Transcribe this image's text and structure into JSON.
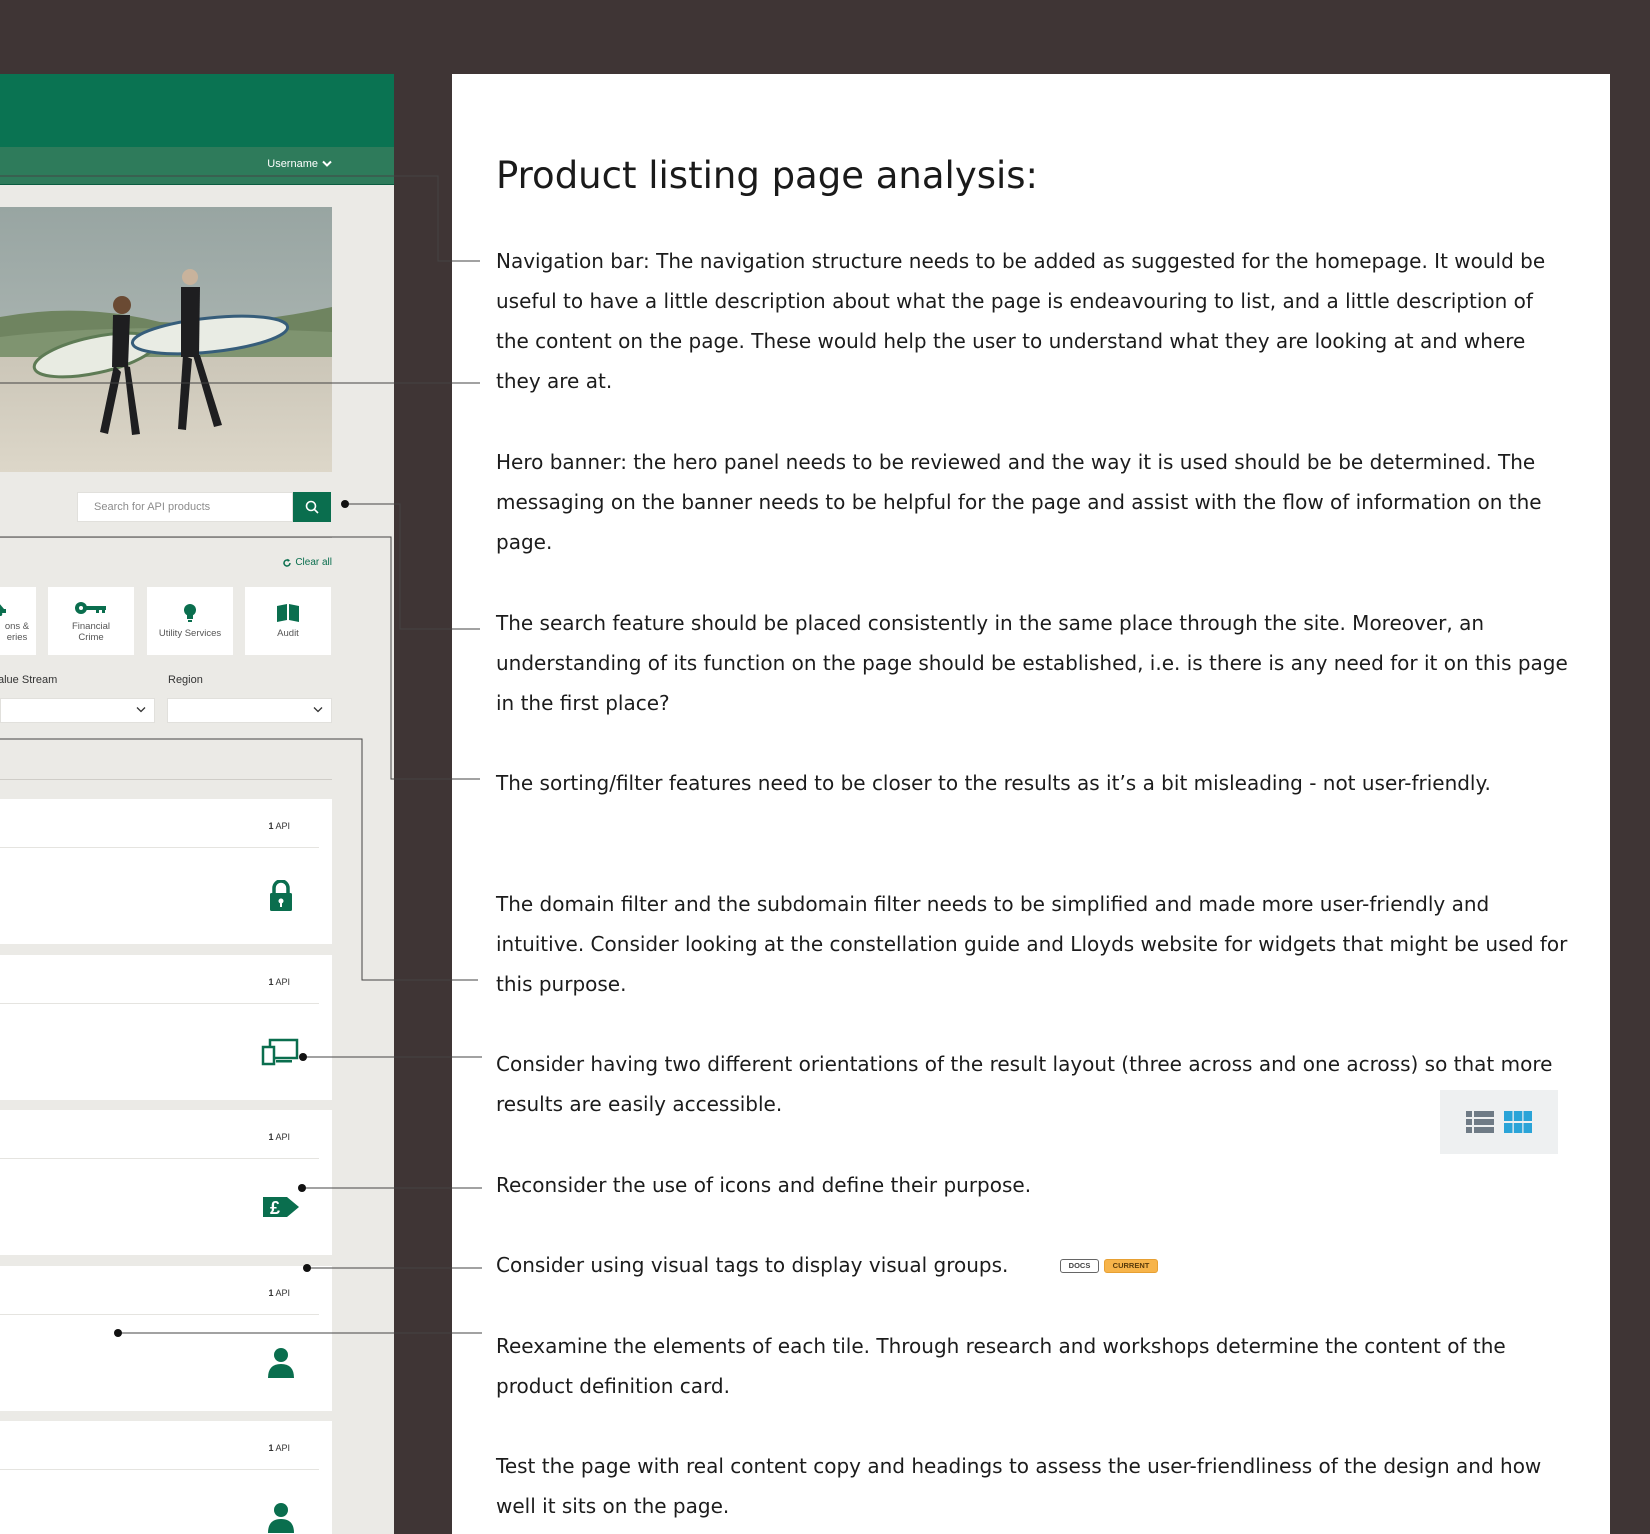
{
  "mockup": {
    "header_user": "Username",
    "search_placeholder": "Search for API products",
    "clear_all": "Clear all",
    "domain_tiles": [
      {
        "label": "ons &\neries",
        "icon": "car-icon"
      },
      {
        "label": "Financial\nCrime",
        "icon": "key-icon"
      },
      {
        "label": "Utility Services",
        "icon": "lightbulb-icon"
      },
      {
        "label": "Audit",
        "icon": "book-icon"
      }
    ],
    "filters": {
      "value_stream_label": "alue Stream",
      "region_label": "Region"
    },
    "cards": [
      {
        "count": "1",
        "unit": "API",
        "icon": "lock-icon"
      },
      {
        "count": "1",
        "unit": "API",
        "icon": "devices-icon"
      },
      {
        "count": "1",
        "unit": "API",
        "icon": "pound-arrow-icon"
      },
      {
        "count": "1",
        "unit": "API",
        "icon": "person-icon"
      },
      {
        "count": "1",
        "unit": "API",
        "icon": "person-icon"
      }
    ],
    "brand_color": "#0a7352"
  },
  "analysis": {
    "title": "Product listing page analysis:",
    "notes": [
      "Navigation bar: The navigation structure needs to be added as suggested for the homepage. It would be useful to have a little description about what the page is endeavouring to list, and a little description of the content on the page. These would help the user to understand what they are looking at and where they are at.",
      "Hero banner: the hero panel needs to be reviewed and the way it is used should be be determined. The messaging on the banner needs to be helpful for the page and assist with the flow of information on the page.",
      "The search feature should be placed consistently in the same place through the site. Moreover, an understanding of its function on the page should be established, i.e. is there is any need for it on this page in the first place?",
      "The sorting/filter features need to be closer to the results as it’s a bit misleading - not user-friendly.",
      "The domain filter and the subdomain filter needs to be simplified and made more user-friendly and intuitive. Consider looking at the constellation guide and Lloyds website for widgets that might be used for this purpose.",
      "Consider having two different orientations of the result layout (three across and one across) so that more results are easily accessible.",
      "Reconsider the use of icons and define their purpose.",
      "Consider using visual tags to display visual groups.",
      "Reexamine the elements of each tile. Through research and workshops determine the content of the product definition card.",
      "Test the page with real content copy and headings to assess the user-friendliness of the design and how well it sits on the page."
    ],
    "tags": [
      "DOCS",
      "CURRENT"
    ],
    "tag_colors": {
      "docs": "#ffffff",
      "current": "#f7b44a"
    },
    "layout_toggle_colors": {
      "list": "#6f7b86",
      "grid": "#2aa4d8"
    }
  }
}
